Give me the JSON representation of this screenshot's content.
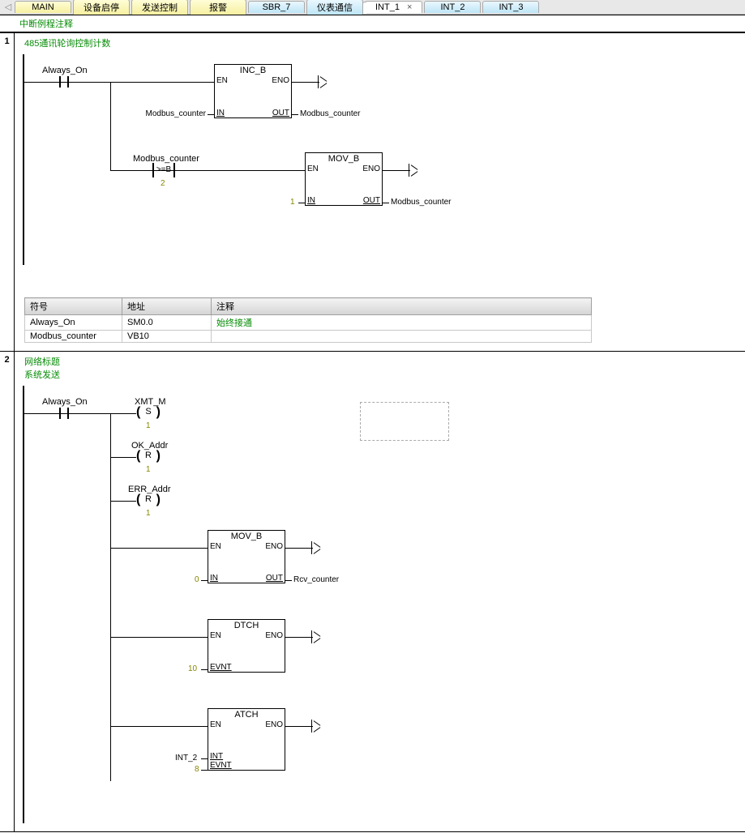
{
  "tabs": {
    "arrow": "◁",
    "items": [
      {
        "label": "MAIN",
        "cls": "yellow"
      },
      {
        "label": "设备启停",
        "cls": "yellow"
      },
      {
        "label": "发送控制",
        "cls": "yellow"
      },
      {
        "label": "报警",
        "cls": "yellow"
      },
      {
        "label": "SBR_7",
        "cls": "blue"
      },
      {
        "label": "仪表通信",
        "cls": "blue"
      },
      {
        "label": "INT_1",
        "cls": "active",
        "closable": true
      },
      {
        "label": "INT_2",
        "cls": "blue"
      },
      {
        "label": "INT_3",
        "cls": "blue"
      }
    ],
    "close_glyph": "×"
  },
  "comment_bar": "中断例程注释",
  "network1": {
    "num": "1",
    "title": "485通讯轮询控制计数",
    "contact_always": "Always_On",
    "fb_inc": {
      "name": "INC_B",
      "en": "EN",
      "eno": "ENO",
      "in": "IN",
      "out": "OUT",
      "in_val": "Modbus_counter",
      "out_val": "Modbus_counter"
    },
    "cmp_top": "Modbus_counter",
    "cmp_op": ">=B",
    "cmp_val": "2",
    "fb_mov": {
      "name": "MOV_B",
      "en": "EN",
      "eno": "ENO",
      "in": "IN",
      "out": "OUT",
      "in_val": "1",
      "out_val": "Modbus_counter"
    },
    "symtab": {
      "hdr": {
        "sym": "符号",
        "addr": "地址",
        "cmt": "注释"
      },
      "rows": [
        {
          "sym": "Always_On",
          "addr": "SM0.0",
          "cmt": "始终接通"
        },
        {
          "sym": "Modbus_counter",
          "addr": "VB10",
          "cmt": ""
        }
      ]
    }
  },
  "network2": {
    "num": "2",
    "title_a": "网络标题",
    "title_b": "系统发送",
    "contact_always": "Always_On",
    "coils": [
      {
        "top": "XMT_M",
        "mid": "S",
        "bot": "1"
      },
      {
        "top": "OK_Addr",
        "mid": "R",
        "bot": "1"
      },
      {
        "top": "ERR_Addr",
        "mid": "R",
        "bot": "1"
      }
    ],
    "fb_mov": {
      "name": "MOV_B",
      "en": "EN",
      "eno": "ENO",
      "in": "IN",
      "out": "OUT",
      "in_val": "0",
      "out_val": "Rcv_counter"
    },
    "fb_dtch": {
      "name": "DTCH",
      "en": "EN",
      "eno": "ENO",
      "evnt": "EVNT",
      "evnt_val": "10"
    },
    "fb_atch": {
      "name": "ATCH",
      "en": "EN",
      "eno": "ENO",
      "int": "INT",
      "evnt": "EVNT",
      "int_val": "INT_2",
      "evnt_val": "8"
    }
  }
}
